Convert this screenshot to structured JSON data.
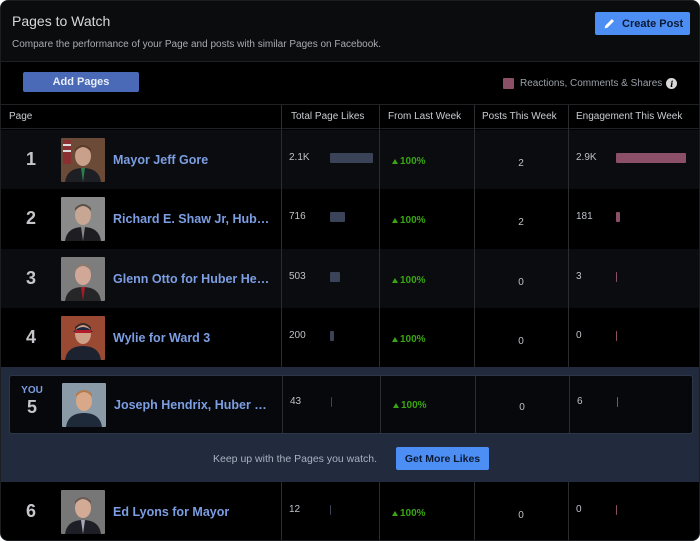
{
  "header": {
    "title": "Pages to Watch",
    "subtitle": "Compare the performance of your Page and posts with similar Pages on Facebook.",
    "create_post_label": "Create Post"
  },
  "toolbar": {
    "add_pages_label": "Add Pages",
    "legend_label": "Reactions, Comments & Shares",
    "legend_color": "#8b4f68"
  },
  "table": {
    "columns": [
      "Page",
      "Total Page Likes",
      "From Last Week",
      "Posts This Week",
      "Engagement This Week"
    ],
    "rows": [
      {
        "rank": "1",
        "name": "Mayor Jeff Gore",
        "likes": "2.1K",
        "likes_num": 2100,
        "growth": "100%",
        "posts": "2",
        "engagement": "2.9K",
        "engagement_num": 2900
      },
      {
        "rank": "2",
        "name": "Richard E. Shaw Jr, Hub…",
        "likes": "716",
        "likes_num": 716,
        "growth": "100%",
        "posts": "2",
        "engagement": "181",
        "engagement_num": 181
      },
      {
        "rank": "3",
        "name": "Glenn Otto for Huber He…",
        "likes": "503",
        "likes_num": 503,
        "growth": "100%",
        "posts": "0",
        "engagement": "3",
        "engagement_num": 3
      },
      {
        "rank": "4",
        "name": "Wylie for Ward 3",
        "likes": "200",
        "likes_num": 200,
        "growth": "100%",
        "posts": "0",
        "engagement": "0",
        "engagement_num": 0
      },
      {
        "rank": "5",
        "name": "Joseph Hendrix, Huber …",
        "likes": "43",
        "likes_num": 43,
        "growth": "100%",
        "posts": "0",
        "engagement": "6",
        "engagement_num": 6,
        "you_label": "YOU"
      },
      {
        "rank": "6",
        "name": "Ed Lyons for Mayor",
        "likes": "12",
        "likes_num": 12,
        "growth": "100%",
        "posts": "0",
        "engagement": "0",
        "engagement_num": 0
      }
    ]
  },
  "promo": {
    "text": "Keep up with the Pages you watch.",
    "button_label": "Get More Likes"
  },
  "colors": {
    "accent": "#4d8ef5",
    "link": "#7c9ee3",
    "growth": "#39a512",
    "likes_bar": "#3b4358",
    "engagement_bar": "#8b4f68"
  }
}
